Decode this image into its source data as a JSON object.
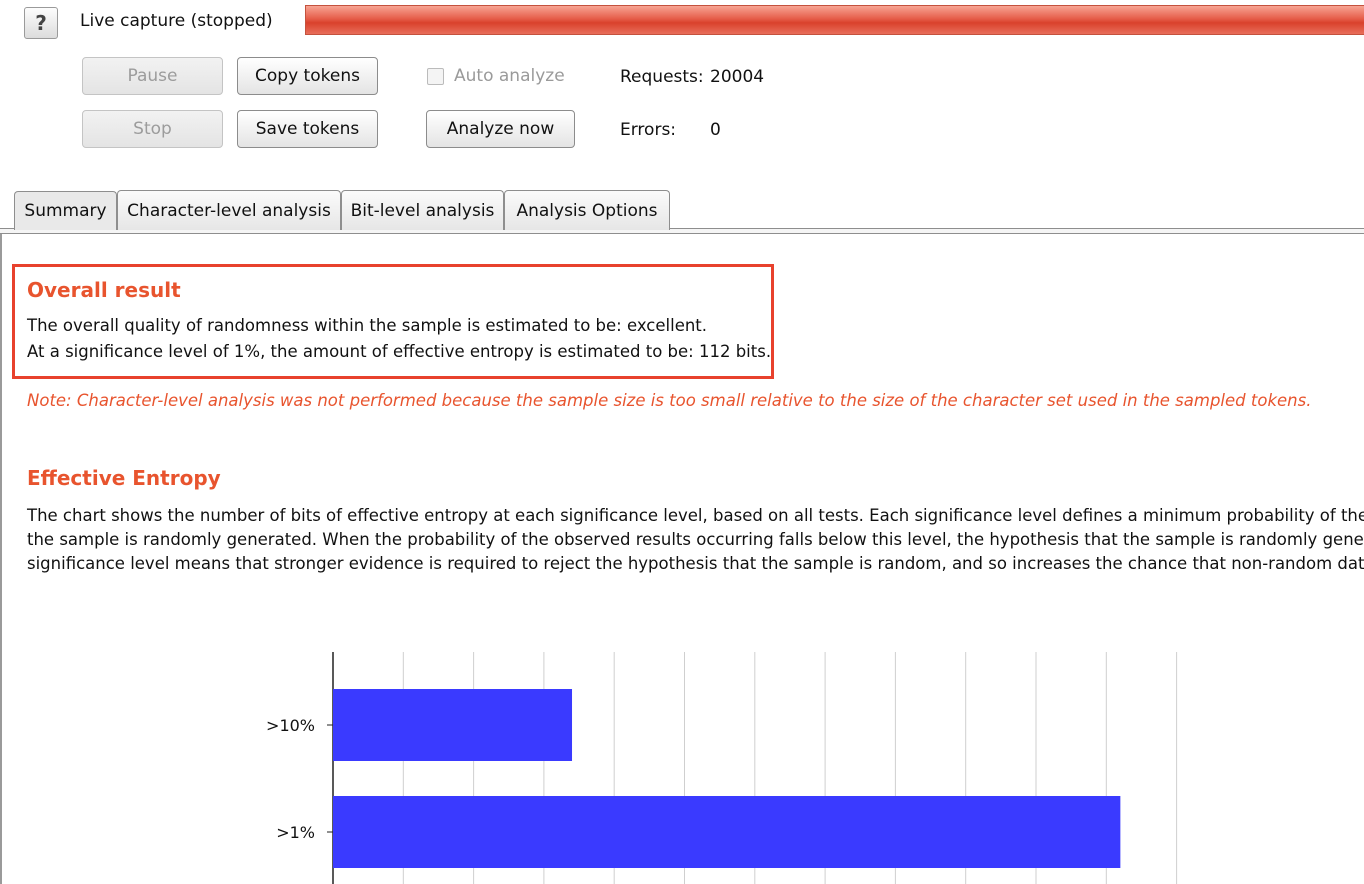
{
  "header": {
    "help_icon": "?",
    "status": "Live capture (stopped)"
  },
  "controls": {
    "pause_label": "Pause",
    "stop_label": "Stop",
    "copy_tokens_label": "Copy tokens",
    "save_tokens_label": "Save tokens",
    "auto_analyze_label": "Auto analyze",
    "auto_analyze_checked": false,
    "analyze_now_label": "Analyze now",
    "requests_label": "Requests:",
    "requests_value": "20004",
    "errors_label": "Errors:",
    "errors_value": "0"
  },
  "tabs": [
    {
      "label": "Summary",
      "active": true
    },
    {
      "label": "Character-level analysis",
      "active": false
    },
    {
      "label": "Bit-level analysis",
      "active": false
    },
    {
      "label": "Analysis Options",
      "active": false
    }
  ],
  "overall": {
    "heading": "Overall result",
    "line1": "The overall quality of randomness within the sample is estimated to be: excellent.",
    "line2": "At a significance level of 1%, the amount of effective entropy is estimated to be: 112 bits."
  },
  "note": "Note: Character-level analysis was not performed because the sample size is too small relative to the size of the character set used in the sampled tokens.",
  "entropy": {
    "heading": "Effective Entropy",
    "line1": "The chart shows the number of bits of effective entropy at each significance level, based on all tests. Each significance level defines a minimum probability of the obs",
    "line2": "the sample is randomly generated. When the probability of the observed results occurring falls below this level, the hypothesis that the sample is randomly generated",
    "line3": "significance level means that stronger evidence is required to reject the hypothesis that the sample is random, and so increases the chance that non-random data will"
  },
  "colors": {
    "accent": "#e8542e",
    "bar": "#3a3aff"
  },
  "chart_data": {
    "type": "bar",
    "orientation": "horizontal",
    "categories": [
      ">10%",
      ">1%"
    ],
    "values": [
      34,
      112
    ],
    "xlim": [
      0,
      120
    ],
    "grid": true
  }
}
